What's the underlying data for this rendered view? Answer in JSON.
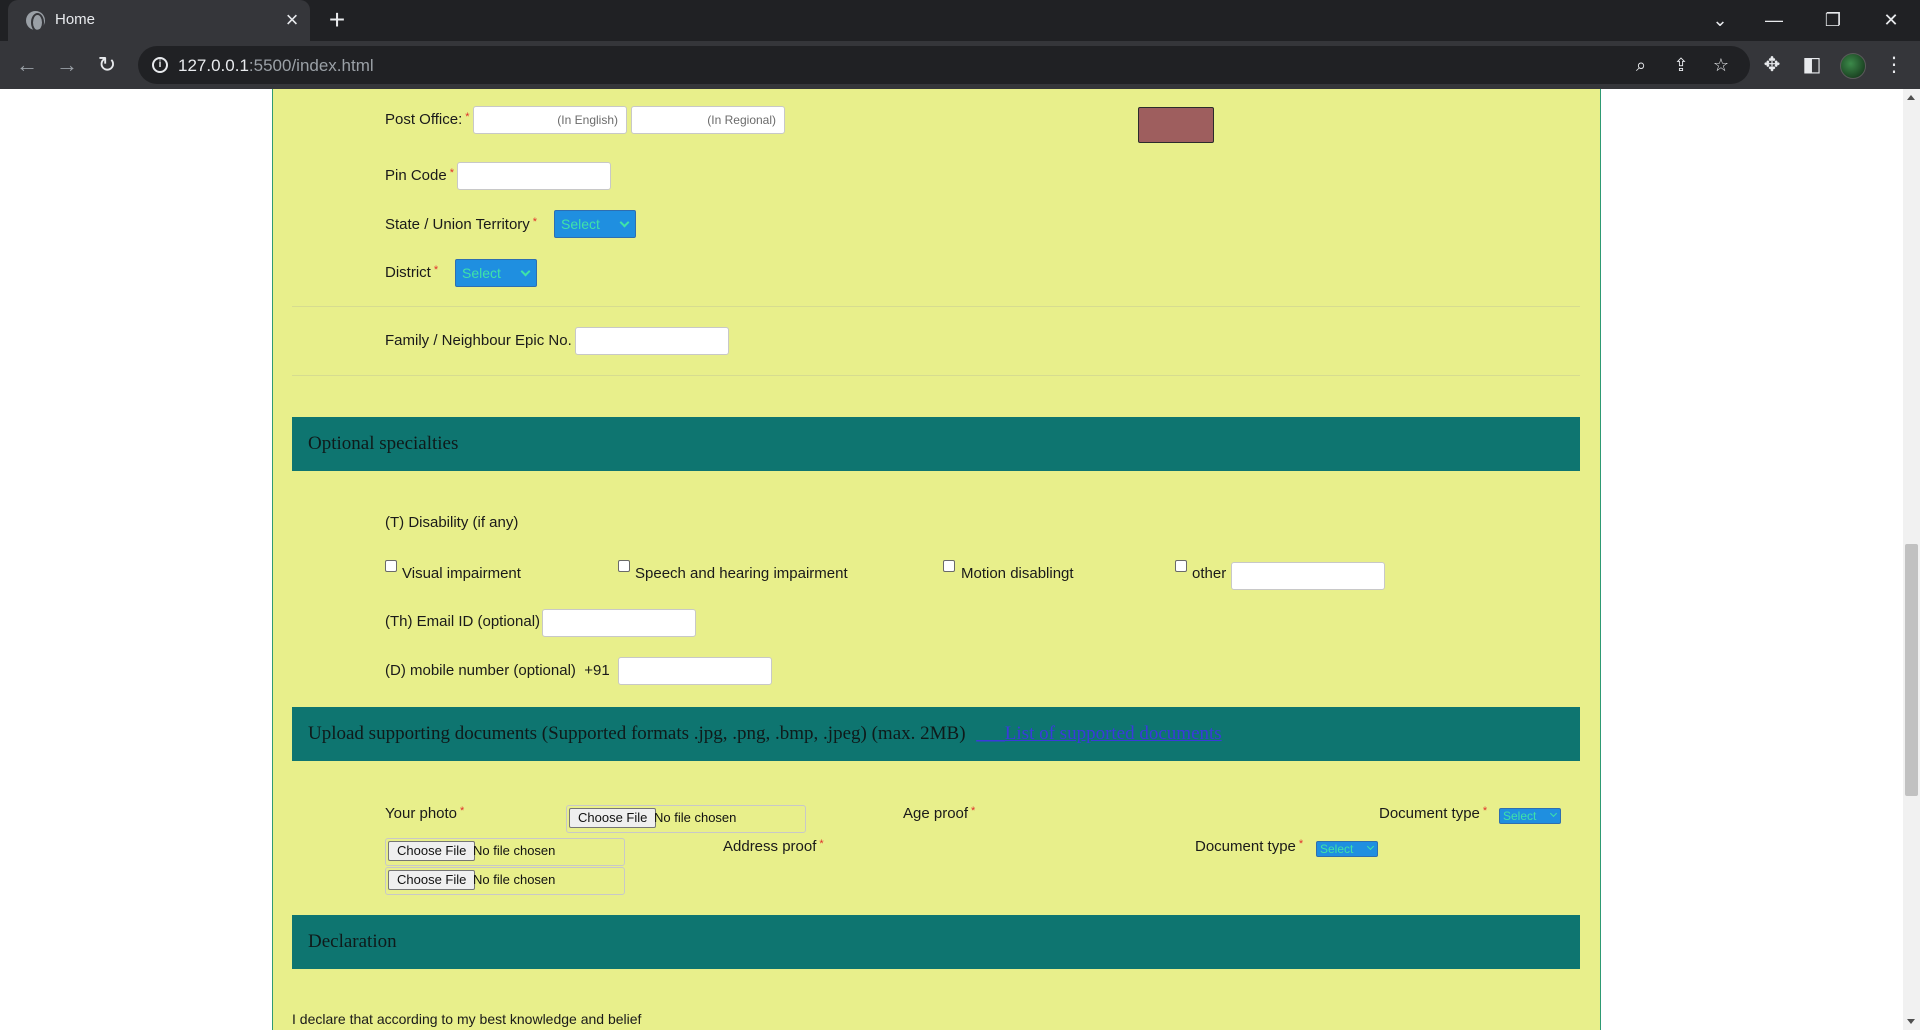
{
  "browser": {
    "tab_title": "Home",
    "url_host": "127.0.0.1",
    "url_rest": ":5500/index.html"
  },
  "address": {
    "post_office_label": "Post Office:",
    "post_office_en_placeholder": "(In English)",
    "post_office_regional_placeholder": "(In Regional)",
    "pin_code_label": "Pin Code",
    "state_label": "State / Union Territory",
    "state_select": "Select",
    "district_label": "District",
    "district_select": "Select",
    "family_epic_label": "Family / Neighbour Epic No.",
    "required_mark": "*"
  },
  "optional": {
    "header": "Optional specialties",
    "disability_label": "(T) Disability (if any)",
    "checkboxes": [
      {
        "label": "Visual impairment"
      },
      {
        "label": "Speech and hearing impairment"
      },
      {
        "label": "Motion disablingt"
      },
      {
        "label": "other"
      }
    ],
    "email_label": "(Th) Email ID (optional)",
    "mobile_label": "(D) mobile number (optional)",
    "mobile_prefix": "+91"
  },
  "upload": {
    "header": "Upload supporting documents (Supported formats .jpg, .png, .bmp, .jpeg) (max. 2MB)",
    "link": "List of supported documents",
    "link_prefix": "___",
    "photo_label": "Your photo",
    "age_label": "Age proof",
    "address_label": "Address proof",
    "doc_type_label": "Document type",
    "select_text": "Select",
    "choose_file": "Choose File",
    "no_file": "No file chosen"
  },
  "declaration": {
    "header": "Declaration",
    "text": "I declare that according to my best knowledge and belief"
  }
}
